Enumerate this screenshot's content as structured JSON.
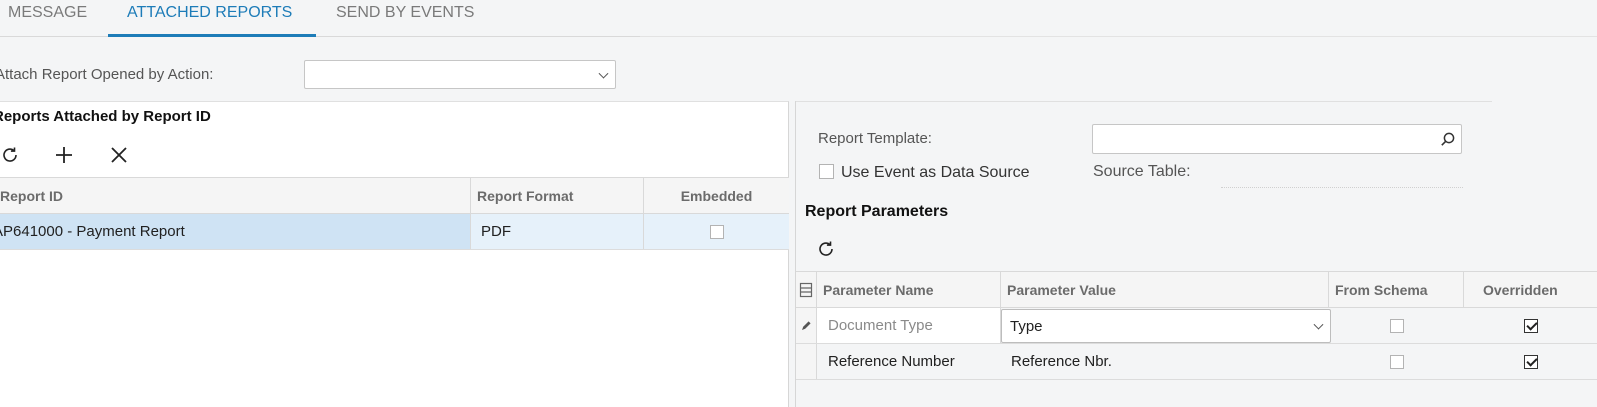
{
  "tabs": [
    {
      "label": "MESSAGE"
    },
    {
      "label": "ATTACHED REPORTS",
      "active": true
    },
    {
      "label": "SEND BY EVENTS"
    }
  ],
  "attach_action": {
    "label": "Attach Report Opened by Action:",
    "value": ""
  },
  "left": {
    "title": "Reports Attached by Report ID",
    "toolbar": {
      "refresh_icon": "refresh-icon",
      "add_icon": "plus-icon",
      "delete_icon": "close-icon"
    },
    "columns": [
      "Report ID",
      "Report Format",
      "Embedded"
    ],
    "rows": [
      {
        "report_id": "AP641000 - Payment Report",
        "format": "PDF",
        "embedded": false
      }
    ]
  },
  "right": {
    "report_template_label": "Report Template:",
    "report_template_value": "",
    "use_event_label": "Use Event as Data Source",
    "use_event_checked": false,
    "source_table_label": "Source Table:",
    "params_title": "Report Parameters",
    "columns": [
      "Parameter Name",
      "Parameter Value",
      "From Schema",
      "Overridden"
    ],
    "rows": [
      {
        "name": "Document Type",
        "value": "Type",
        "from_schema": false,
        "overridden": true,
        "editing": true
      },
      {
        "name": "Reference Number",
        "value": "Reference Nbr.",
        "from_schema": false,
        "overridden": true,
        "editing": false
      }
    ]
  },
  "colors": {
    "accent": "#1d7cb8",
    "selected_row": "#cfe3f4",
    "selected_row_light": "#e6f1fa"
  }
}
